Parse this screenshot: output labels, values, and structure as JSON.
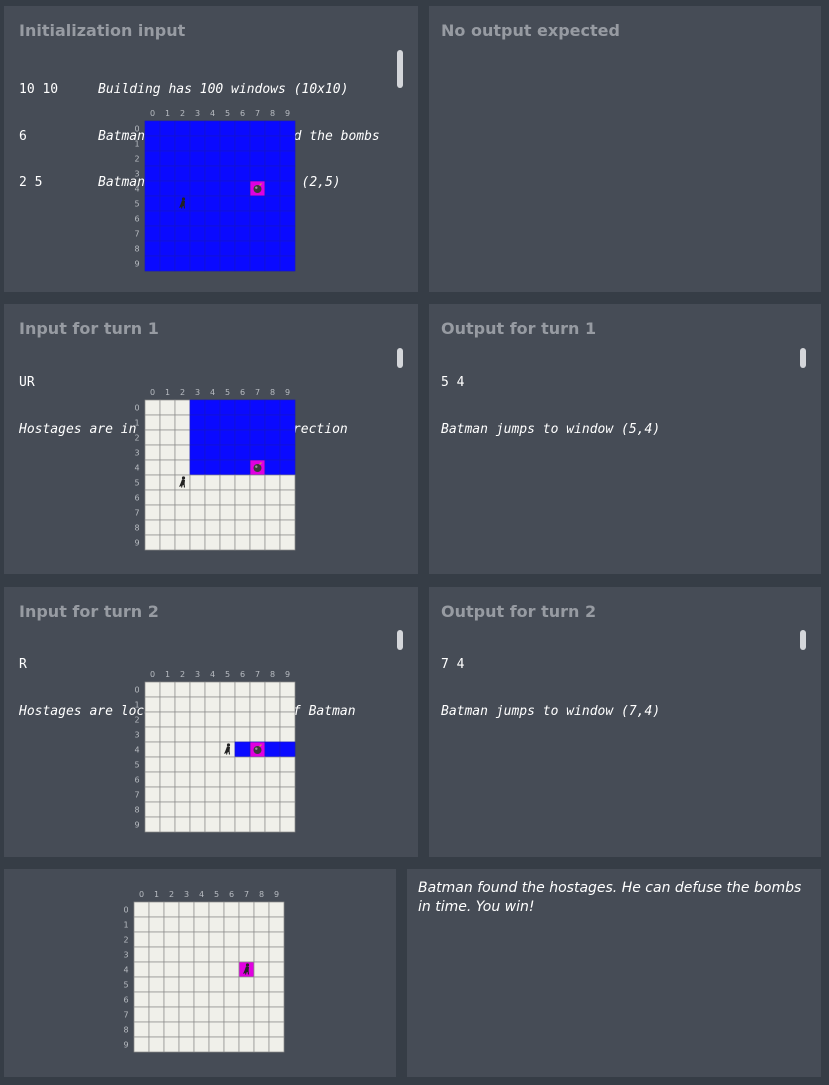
{
  "panels": {
    "init": {
      "title": "Initialization input",
      "lines": [
        {
          "code": "10 10",
          "comment": "Building has 100 windows (10x10)"
        },
        {
          "code": "6",
          "comment": "Batman has 6 jumps to find the bombs"
        },
        {
          "code": "2 5",
          "comment": "Batman starts at position (2,5)"
        }
      ]
    },
    "init_output": {
      "title": "No output expected"
    },
    "turn1_input": {
      "title": "Input for turn 1",
      "value": "UR",
      "comment": "Hostages are in the upward-right direction"
    },
    "turn1_output": {
      "title": "Output for turn 1",
      "value": "5 4",
      "comment": "Batman jumps to window (5,4)"
    },
    "turn2_input": {
      "title": "Input for turn 2",
      "value": "R",
      "comment": "Hostages are located to the right of Batman"
    },
    "turn2_output": {
      "title": "Output for turn 2",
      "value": "7 4",
      "comment": "Batman jumps to window (7,4)"
    },
    "result": {
      "message": "Batman found the hostages. He can defuse the bombs in time. You win!"
    }
  },
  "grids": {
    "axis_labels": [
      "0",
      "1",
      "2",
      "3",
      "4",
      "5",
      "6",
      "7",
      "8",
      "9"
    ],
    "colors": {
      "active": "#0a0aff",
      "inactive": "#f0f0ea",
      "bomb": "#e000e0",
      "line_active": "#1515c8",
      "line_inactive": "#8a8a8a"
    },
    "boards": [
      {
        "name": "init-grid",
        "active_x": [
          0,
          9
        ],
        "active_y": [
          0,
          9
        ],
        "batman": [
          2,
          5
        ],
        "bomb": [
          7,
          4
        ],
        "show_bomb_icon": true
      },
      {
        "name": "turn1-grid",
        "active_x": [
          3,
          9
        ],
        "active_y": [
          0,
          4
        ],
        "batman": [
          2,
          5
        ],
        "bomb": [
          7,
          4
        ],
        "show_bomb_icon": true
      },
      {
        "name": "turn2-grid",
        "active_x": [
          6,
          9
        ],
        "active_y": [
          4,
          4
        ],
        "batman": [
          5,
          4
        ],
        "bomb": [
          7,
          4
        ],
        "show_bomb_icon": true
      },
      {
        "name": "final-grid",
        "active_x": null,
        "active_y": null,
        "batman": [
          7,
          4
        ],
        "bomb": [
          7,
          4
        ],
        "show_bomb_icon": false
      }
    ]
  }
}
